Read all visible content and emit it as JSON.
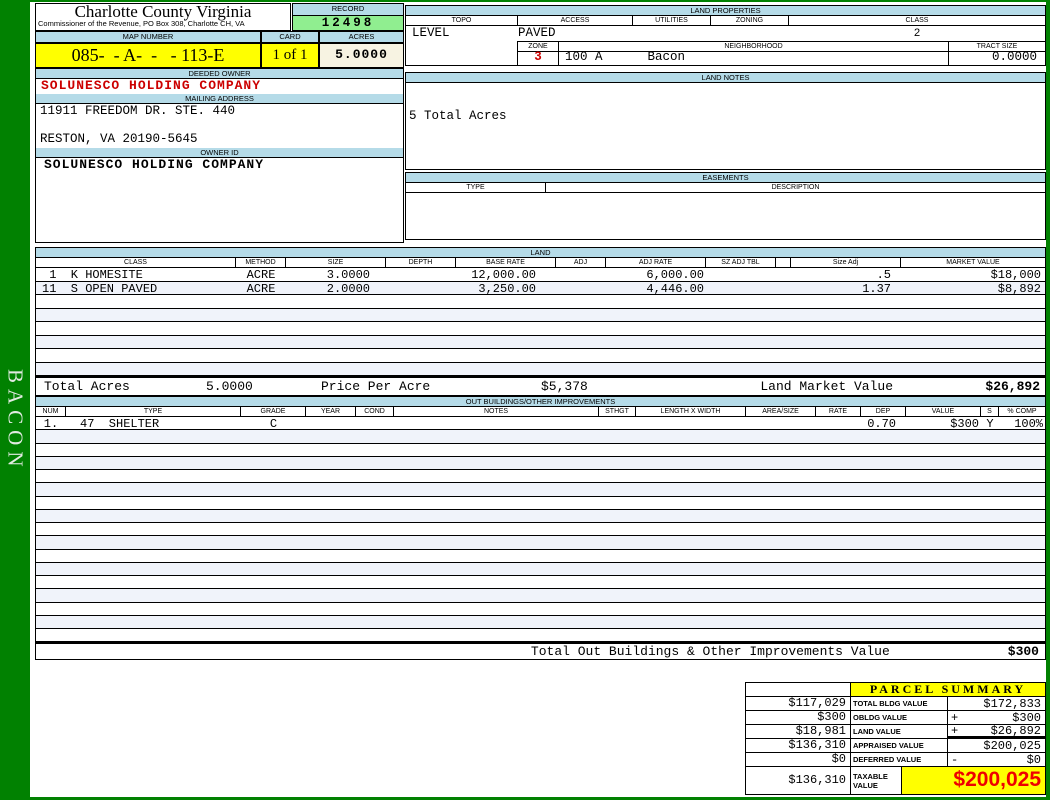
{
  "colors": {
    "page_green": "#018101",
    "section_blue": "#b5dbe8",
    "record_green": "#90ee90",
    "highlight_yellow": "#ffff00",
    "acres_cream": "#f7f3e2",
    "owner_red": "#cc0000",
    "taxable_red": "#ee0000",
    "row_stripe": "#f0f3fa"
  },
  "sidebar": {
    "vertical_label": "BACON"
  },
  "header": {
    "county_title": "Charlotte County Virginia",
    "county_subtitle": "Commissioner of the Revenue, PO Box 308, Charlotte CH, VA",
    "record_label": "RECORD",
    "record_value": "12498",
    "map_number_label": "MAP NUMBER",
    "map_number_value": "085-  - A-  -   - 113-E",
    "card_label": "CARD",
    "card_value": "1 of 1",
    "acres_label": "ACRES",
    "acres_value": "5.0000"
  },
  "owner": {
    "deeded_owner_label": "DEEDED OWNER",
    "deeded_owner_value": "SOLUNESCO HOLDING COMPANY",
    "mailing_address_label": "MAILING ADDRESS",
    "address_line1": "11911 FREEDOM DR. STE. 440",
    "address_line2": "RESTON, VA 20190-5645",
    "owner_id_label": "OWNER ID",
    "owner_id_value": "SOLUNESCO HOLDING COMPANY"
  },
  "land_properties": {
    "title": "LAND PROPERTIES",
    "col_topo": "TOPO",
    "col_access": "ACCESS",
    "col_utilities": "UTILITIES",
    "col_zoning": "ZONING",
    "col_class": "CLASS",
    "topo_value": "LEVEL",
    "access_value": "PAVED",
    "utilities_value": "",
    "zoning_value": "",
    "class_value": "2",
    "zone_label": "ZONE",
    "zone_value": "3",
    "neighborhood_label": "NEIGHBORHOOD",
    "neighborhood_value": "100 A      Bacon",
    "tract_size_label": "TRACT SIZE",
    "tract_size_value": "0.0000"
  },
  "land_notes": {
    "title": "LAND NOTES",
    "note": "5 Total Acres"
  },
  "easements": {
    "title": "EASEMENTS",
    "col_type": "TYPE",
    "col_description": "DESCRIPTION"
  },
  "land": {
    "title": "LAND",
    "headers": [
      "CLASS",
      "METHOD",
      "SIZE",
      "DEPTH",
      "BASE RATE",
      "ADJ",
      "ADJ RATE",
      "SZ ADJ TBL",
      "",
      "Size Adj",
      "MARKET VALUE"
    ],
    "rows": [
      {
        "class": " 1  K HOMESITE",
        "method": "ACRE",
        "size": "3.0000",
        "depth": "",
        "base_rate": "12,000.00",
        "adj": "",
        "adj_rate": "6,000.00",
        "sz_adj_tbl": "",
        "size_adj": ".5",
        "market_value": "$18,000"
      },
      {
        "class": "11  S OPEN PAVED",
        "method": "ACRE",
        "size": "2.0000",
        "depth": "",
        "base_rate": "3,250.00",
        "adj": "",
        "adj_rate": "4,446.00",
        "sz_adj_tbl": "",
        "size_adj": "1.37",
        "market_value": "$8,892"
      }
    ],
    "totals": {
      "total_acres_label": "Total Acres",
      "total_acres_value": "5.0000",
      "price_per_acre_label": "Price Per Acre",
      "price_per_acre_value": "$5,378",
      "land_market_value_label": "Land Market Value",
      "land_market_value_value": "$26,892"
    }
  },
  "out_buildings": {
    "title": "OUT BUILDINGS/OTHER IMPROVEMENTS",
    "headers": [
      "NUM",
      "TYPE",
      "GRADE",
      "YEAR",
      "COND",
      "NOTES",
      "STHGT",
      "LENGTH X WIDTH",
      "AREA/SIZE",
      "RATE",
      "DEP",
      "VALUE",
      "S",
      "% COMP"
    ],
    "rows": [
      {
        "num": "1.",
        "type": "47  SHELTER",
        "grade": "C",
        "year": "",
        "cond": "",
        "notes": "",
        "sthgt": "",
        "length_x_width": "",
        "area_size": "",
        "rate": "",
        "dep": "0.70",
        "value": "$300",
        "s": "Y",
        "pct_comp": "100%"
      }
    ],
    "total_label": "Total Out Buildings & Other Improvements Value",
    "total_value": "$300"
  },
  "parcel_summary": {
    "title": "PARCEL SUMMARY",
    "rows": [
      {
        "prior": "$117,029",
        "label": "TOTAL BLDG VALUE",
        "op": "",
        "value": "$172,833"
      },
      {
        "prior": "$300",
        "label": "OBLDG VALUE",
        "op": "+",
        "value": "$300"
      },
      {
        "prior": "$18,981",
        "label": "LAND VALUE",
        "op": "+",
        "value": "$26,892"
      },
      {
        "prior": "$136,310",
        "label": "APPRAISED VALUE",
        "op": "",
        "value": "$200,025"
      },
      {
        "prior": "$0",
        "label": "DEFERRED VALUE",
        "op": "-",
        "value": "$0"
      }
    ],
    "taxable": {
      "prior": "$136,310",
      "label": "TAXABLE VALUE",
      "value": "$200,025"
    }
  }
}
